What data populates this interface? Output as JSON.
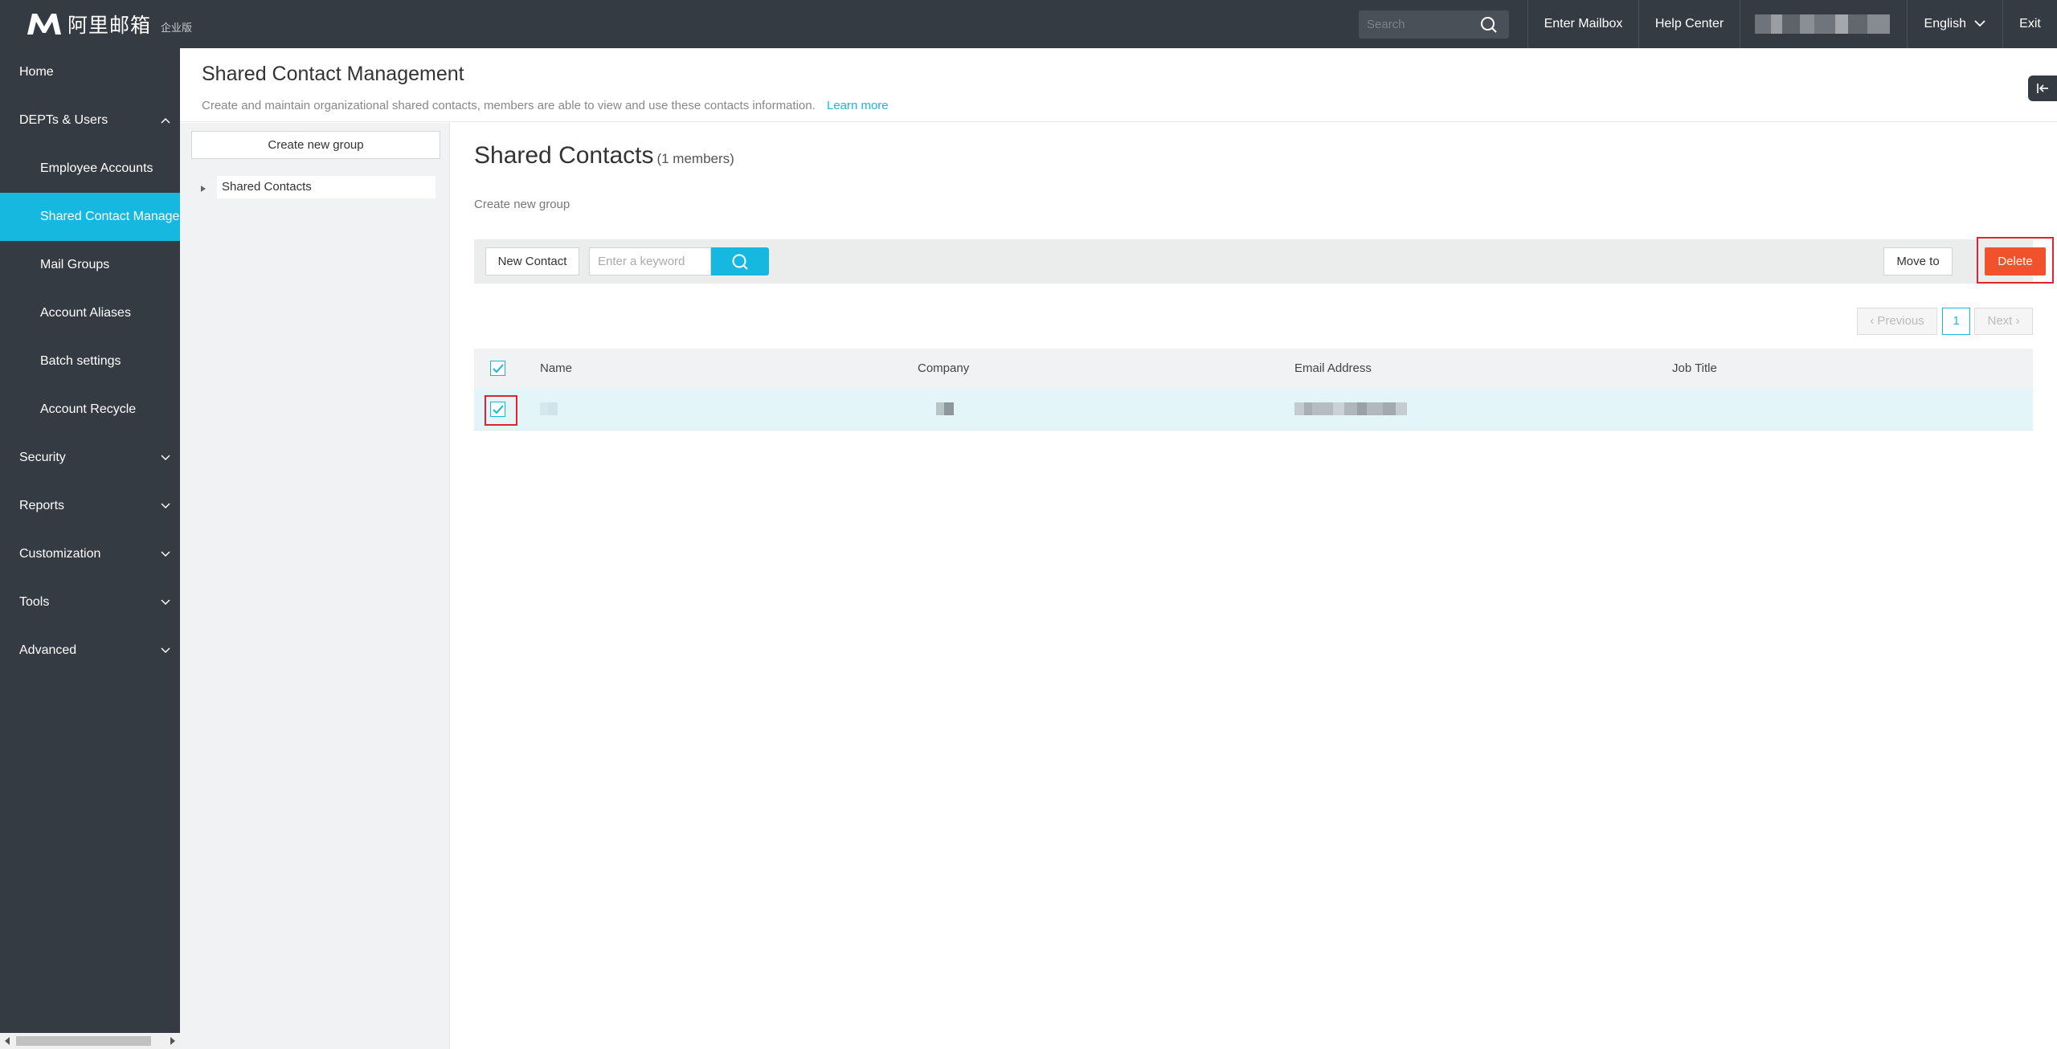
{
  "topbar": {
    "logo_text": "阿里邮箱",
    "logo_sub": "企业版",
    "search_placeholder": "Search",
    "enter_mailbox": "Enter Mailbox",
    "help_center": "Help Center",
    "language": "English",
    "exit": "Exit"
  },
  "sidebar": {
    "items": [
      {
        "label": "Home"
      },
      {
        "label": "DEPTs & Users"
      },
      {
        "label": "Employee Accounts"
      },
      {
        "label": "Shared Contact Managem"
      },
      {
        "label": "Mail Groups"
      },
      {
        "label": "Account Aliases"
      },
      {
        "label": "Batch settings"
      },
      {
        "label": "Account Recycle"
      },
      {
        "label": "Security"
      },
      {
        "label": "Reports"
      },
      {
        "label": "Customization"
      },
      {
        "label": "Tools"
      },
      {
        "label": "Advanced"
      }
    ]
  },
  "header": {
    "title": "Shared Contact Management",
    "description": "Create and maintain organizational shared contacts, members are able to view and use these contacts information.",
    "learn_more": "Learn more"
  },
  "groups": {
    "create_label": "Create new group",
    "tree": [
      {
        "label": "Shared Contacts"
      }
    ]
  },
  "main": {
    "title": "Shared Contacts",
    "count": "(1 members)",
    "create_group_link": "Create new group",
    "toolbar": {
      "new_contact": "New Contact",
      "keyword_placeholder": "Enter a keyword",
      "move_to": "Move to",
      "delete": "Delete"
    },
    "pager": {
      "previous": "‹ Previous",
      "current": "1",
      "next": "Next ›"
    },
    "table": {
      "columns": [
        "Name",
        "Company",
        "Email Address",
        "Job Title"
      ],
      "rows_selected": 1
    }
  },
  "colors": {
    "sidebar_bg": "#353b43",
    "accent": "#16b8e0",
    "delete": "#f0532b",
    "highlight_border": "#e0242f"
  }
}
